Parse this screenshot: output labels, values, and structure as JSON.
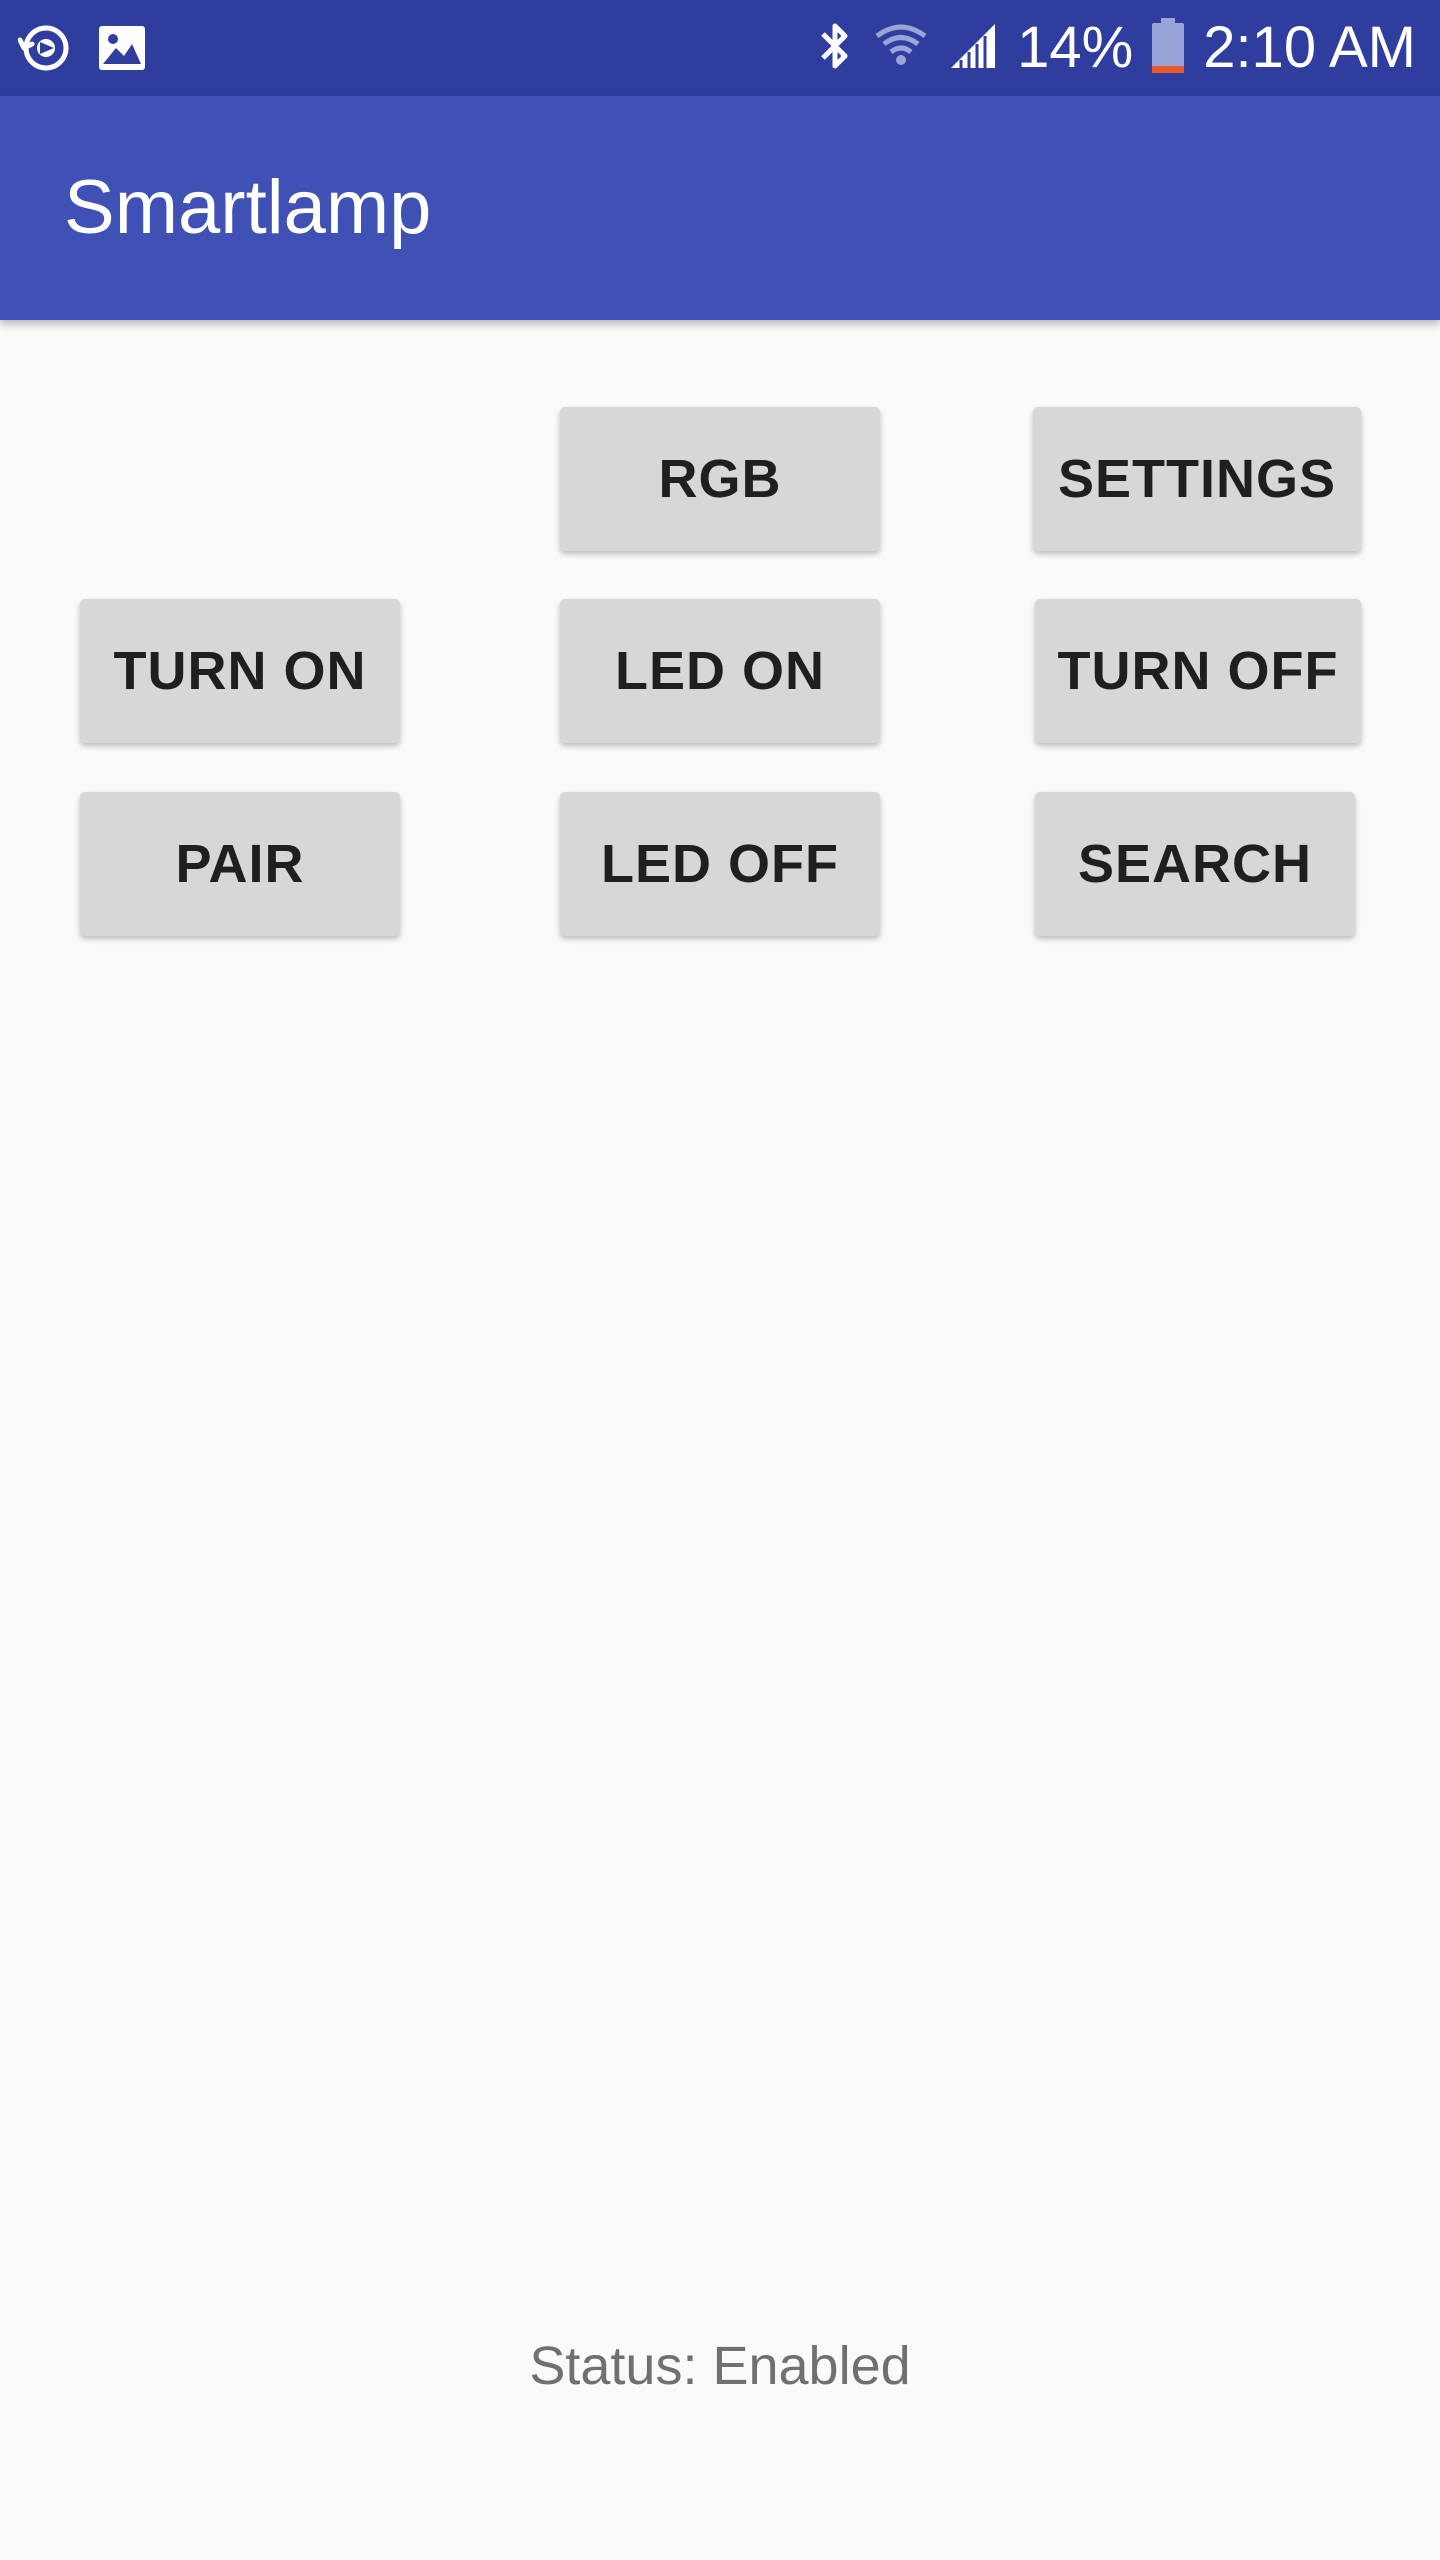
{
  "status_bar": {
    "icons_left": [
      "sync-icon",
      "image-icon"
    ],
    "icons_right": [
      "bluetooth-icon",
      "wifi-icon",
      "signal-icon",
      "battery-icon"
    ],
    "battery_percent": "14%",
    "time": "2:10 AM",
    "battery_level": 0.14
  },
  "app_bar": {
    "title": "Smartlamp"
  },
  "buttons": {
    "rgb": "RGB",
    "settings": "SETTINGS",
    "turn_on": "TURN ON",
    "led_on": "LED ON",
    "turn_off": "TURN OFF",
    "pair": "PAIR",
    "led_off": "LED OFF",
    "search": "SEARCH"
  },
  "status": {
    "text": "Status: Enabled"
  },
  "colors": {
    "status_bar": "#2f3e9e",
    "app_bar": "#3f51b5",
    "button_bg": "#d6d7d7",
    "background": "#fafafa",
    "battery_low": "#e8582a"
  }
}
